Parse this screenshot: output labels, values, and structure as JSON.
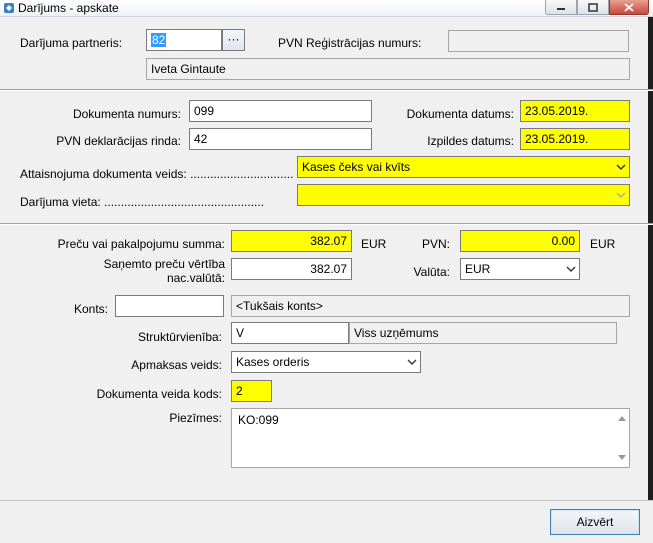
{
  "window": {
    "title": "Darījums - apskate"
  },
  "partner": {
    "label": "Darījuma partneris:",
    "code": "82",
    "browse_label": "···",
    "name": "Iveta Gintaute",
    "vat_reg_label": "PVN Reģistrācijas numurs:",
    "vat_reg_value": ""
  },
  "document": {
    "number_label": "Dokumenta numurs:",
    "number": "099",
    "vat_row_label": "PVN deklarācijas rinda:",
    "vat_row": "42",
    "date_label": "Dokumenta datums:",
    "date": "23.05.2019.",
    "exec_date_label": "Izpildes datums:",
    "exec_date": "23.05.2019.",
    "justification_label": "Attaisnojuma dokumenta veids: ...............................",
    "justification": "Kases čeks vai kvīts",
    "place_label": "Darījuma vieta: ................................................",
    "place": ""
  },
  "amounts": {
    "sum_label": "Preču vai pakalpojumu summa:",
    "sum": "382.07",
    "currency1": "EUR",
    "vat_label": "PVN:",
    "vat": "0.00",
    "currency2": "EUR",
    "received_label_1": "Saņemto preču vērtība",
    "received_label_2": "nac.valūtā:",
    "received": "382.07",
    "currency_label": "Valūta:",
    "currency": "EUR"
  },
  "accounting": {
    "account_label": "Konts:",
    "account_code": "",
    "account_name": "<Tukšais konts>",
    "unit_label": "Struktūrvienība:",
    "unit_code": "V",
    "unit_name": "Viss uzņēmums",
    "payment_label": "Apmaksas veids:",
    "payment": "Kases orderis",
    "doc_type_code_label": "Dokumenta veida kods:",
    "doc_type_code": "2",
    "notes_label": "Piezīmes:",
    "notes": "KO:099"
  },
  "footer": {
    "close_label": "Aizvērt"
  },
  "colors": {
    "highlight": "#ffff00",
    "button_border": "#3c7fb1",
    "close_button": "#c8483b"
  }
}
